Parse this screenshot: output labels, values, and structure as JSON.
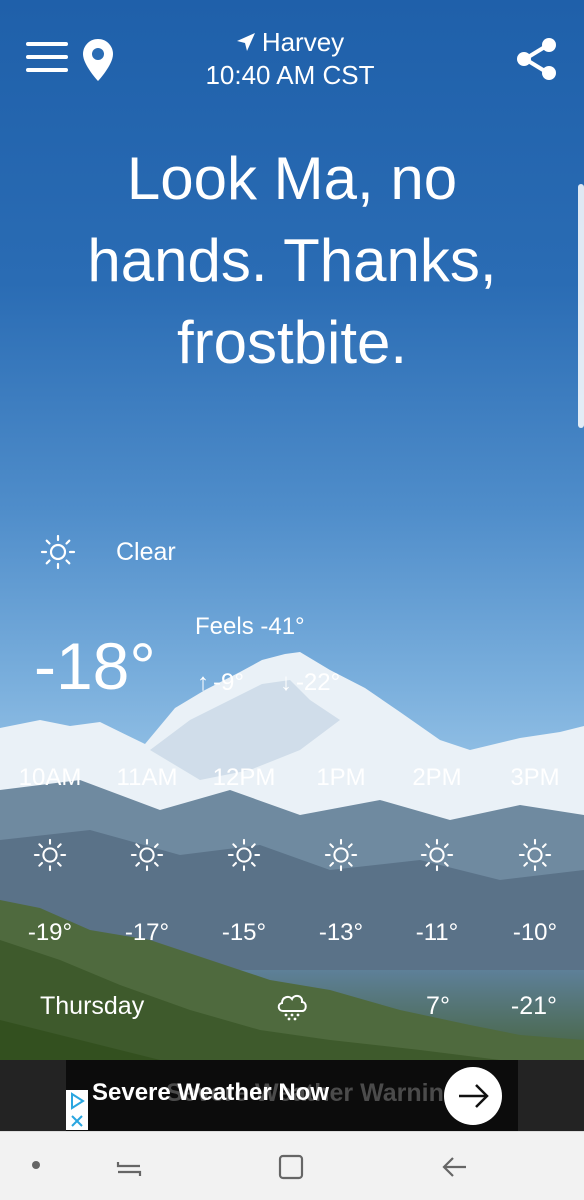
{
  "location": {
    "name": "Harvey",
    "time": "10:40 AM CST"
  },
  "headline": "Look Ma, no hands. Thanks, frostbite.",
  "current": {
    "condition": "Clear",
    "condition_icon": "sun-icon",
    "temperature": "-18°",
    "feels_like": "Feels -41°",
    "high": "-9°",
    "low": "-22°"
  },
  "hourly": [
    {
      "time": "10AM",
      "temp": "-19°",
      "icon": "sun-icon"
    },
    {
      "time": "11AM",
      "temp": "-17°",
      "icon": "sun-icon"
    },
    {
      "time": "12PM",
      "temp": "-15°",
      "icon": "sun-icon"
    },
    {
      "time": "1PM",
      "temp": "-13°",
      "icon": "sun-icon"
    },
    {
      "time": "2PM",
      "temp": "-11°",
      "icon": "sun-icon"
    },
    {
      "time": "3PM",
      "temp": "-10°",
      "icon": "sun-icon"
    }
  ],
  "daily": [
    {
      "day": "Thursday",
      "icon": "snow-cloud-icon",
      "high": "7°",
      "low": "-21°"
    }
  ],
  "ad": {
    "text": "Severe Weather Now",
    "ghost_text": "Severe Weather Warning"
  },
  "colors": {
    "sky_top": "#1f60aa",
    "ad_background": "#0c0c0c",
    "navbar": "#f2f2f2"
  }
}
